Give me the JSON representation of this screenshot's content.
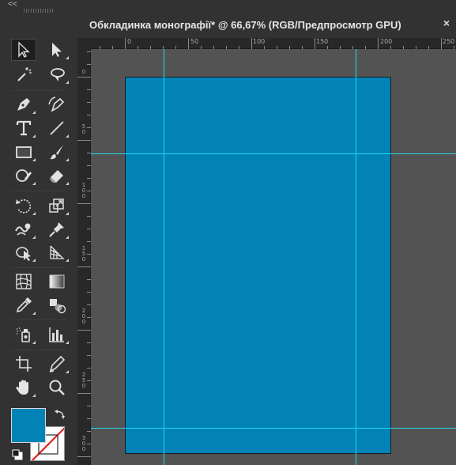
{
  "toolbar": {
    "collapse_label": "<<",
    "tools": [
      {
        "name": "selection-tool-icon"
      },
      {
        "name": "direct-selection-tool-icon"
      },
      {
        "name": "magic-wand-tool-icon"
      },
      {
        "name": "lasso-tool-icon"
      },
      {
        "name": "pen-tool-icon"
      },
      {
        "name": "curvature-tool-icon"
      },
      {
        "name": "type-tool-icon"
      },
      {
        "name": "line-segment-tool-icon"
      },
      {
        "name": "rectangle-tool-icon"
      },
      {
        "name": "paintbrush-tool-icon"
      },
      {
        "name": "shaper-tool-icon"
      },
      {
        "name": "eraser-tool-icon"
      },
      {
        "name": "rotate-tool-icon"
      },
      {
        "name": "scale-tool-icon"
      },
      {
        "name": "warp-tool-icon"
      },
      {
        "name": "puppet-warp-tool-icon"
      },
      {
        "name": "shape-builder-tool-icon"
      },
      {
        "name": "perspective-grid-tool-icon"
      },
      {
        "name": "mesh-tool-icon"
      },
      {
        "name": "gradient-tool-icon"
      },
      {
        "name": "eyedropper-tool-icon"
      },
      {
        "name": "blend-tool-icon"
      },
      {
        "name": "symbol-sprayer-tool-icon"
      },
      {
        "name": "column-graph-tool-icon"
      },
      {
        "name": "artboard-tool-icon"
      },
      {
        "name": "slice-tool-icon"
      },
      {
        "name": "hand-tool-icon"
      },
      {
        "name": "zoom-tool-icon"
      }
    ],
    "fill_color": "#0183b7",
    "stroke_color": "none"
  },
  "document": {
    "title": "Обкладинка монографії* @ 66,67% (RGB/Предпросмотр GPU)",
    "close_label": "×",
    "artboard_color": "#0183b7",
    "guide_color": "#22d6f0"
  },
  "rulers": {
    "horizontal_labels": [
      "0",
      "50",
      "100",
      "150",
      "200",
      "250"
    ],
    "vertical_labels": [
      "0",
      "50",
      "100",
      "150",
      "200",
      "250",
      "300"
    ]
  }
}
